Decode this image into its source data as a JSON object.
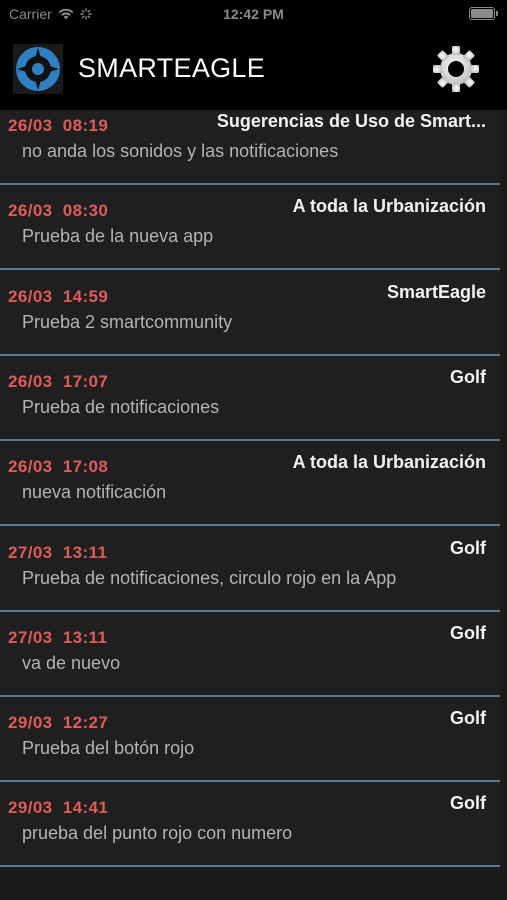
{
  "status_bar": {
    "carrier": "Carrier",
    "time": "12:42 PM"
  },
  "header": {
    "title": "SMARTEAGLE",
    "icons": {
      "logo": "smarteagle-logo",
      "settings": "gear-icon"
    },
    "colors": {
      "logo_blue": "#2e7fc4",
      "background": "#000000"
    }
  },
  "colors": {
    "date": "#e15a5a",
    "separator": "#5a7896",
    "sender": "#f2f2f2",
    "message": "#b3b3b3"
  },
  "notifications": [
    {
      "date": "26/03  08:19",
      "sender": "Sugerencias de Uso de Smart...",
      "message": "no anda los sonidos y las notificaciones"
    },
    {
      "date": "26/03  08:30",
      "sender": "A toda la Urbanización",
      "message": "Prueba de la nueva app"
    },
    {
      "date": "26/03  14:59",
      "sender": "SmartEagle",
      "message": "Prueba 2 smartcommunity"
    },
    {
      "date": "26/03  17:07",
      "sender": "Golf",
      "message": "Prueba de notificaciones"
    },
    {
      "date": "26/03  17:08",
      "sender": "A toda la Urbanización",
      "message": "nueva notificación"
    },
    {
      "date": "27/03  13:11",
      "sender": "Golf",
      "message": "Prueba de notificaciones, circulo rojo en la App"
    },
    {
      "date": "27/03  13:11",
      "sender": "Golf",
      "message": "va de nuevo"
    },
    {
      "date": "29/03  12:27",
      "sender": "Golf",
      "message": "Prueba del botón rojo"
    },
    {
      "date": "29/03  14:41",
      "sender": "Golf",
      "message": "prueba del punto rojo con numero"
    }
  ]
}
